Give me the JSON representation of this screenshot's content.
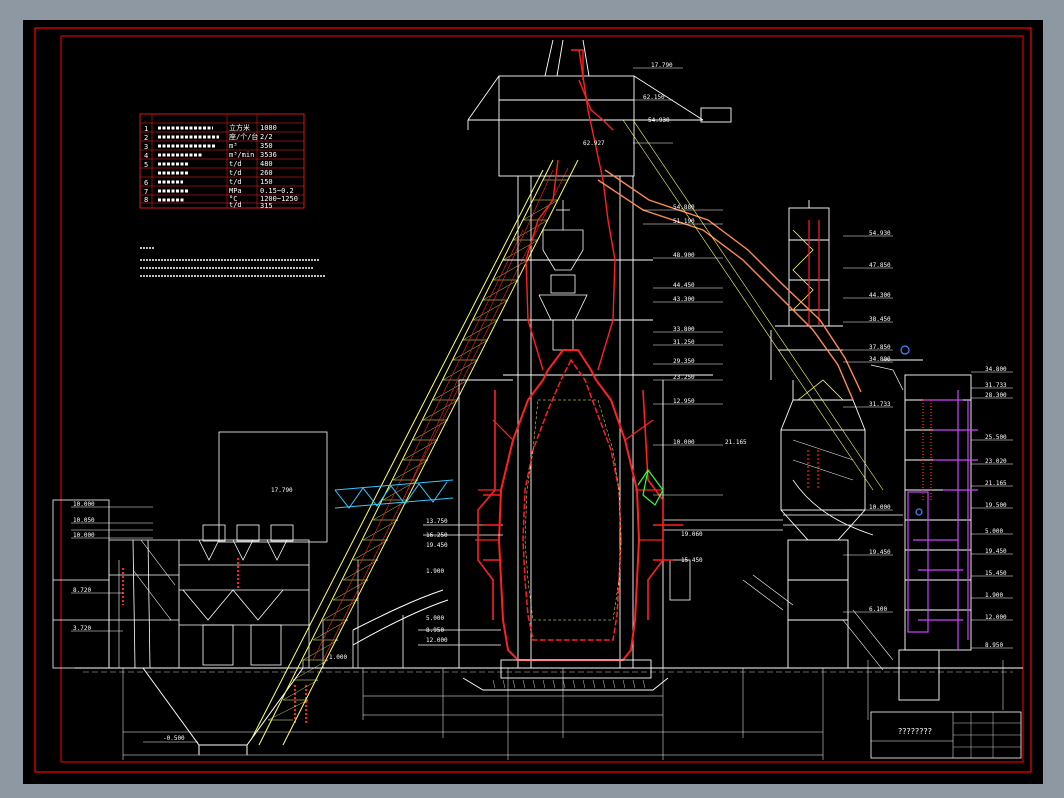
{
  "title_block": {
    "title": "????????"
  },
  "spec_table": {
    "numbers": [
      "1",
      "2",
      "3",
      "4",
      "5",
      "6",
      "7",
      "8"
    ],
    "units": [
      "立方米",
      "座/个/台",
      "m³",
      "m³/min",
      "t/d",
      "t/h",
      "MPa",
      "°C",
      "t/d",
      "t/d",
      "t/h"
    ],
    "values": [
      "1080",
      "2/2",
      "350",
      "3536",
      "480",
      "260",
      "150",
      "0.15~0.2",
      "1200~1250",
      "315"
    ]
  },
  "elevations": [
    "17.790",
    "62.927",
    "54.880",
    "51.190",
    "48.900",
    "44.450",
    "43.300",
    "33.800",
    "31.250",
    "29.350",
    "23.250",
    "12.950",
    "10.000",
    "62.150",
    "54.930",
    "47.850",
    "44.300",
    "38.450",
    "37.850",
    "34.800",
    "31.733",
    "28.300",
    "25.500",
    "23.020",
    "21.165",
    "19.500",
    "10.000",
    "6.100",
    "13.750",
    "16.250",
    "19.450",
    "19.060",
    "15.450",
    "12.000",
    "8.950",
    "5.000",
    "1.900",
    "10.000",
    "10.050",
    "8.720",
    "3.720",
    "1.000",
    "-0.500"
  ],
  "colors": {
    "background": "#000000",
    "border": "#ff0000",
    "structure": "#ffffff",
    "furnace": "#ff2020",
    "trestle": "#ffff66",
    "pipe": "#ff8a50",
    "bridge": "#33c8ff",
    "equipment": "#cc44ff",
    "highlight": "#33ff33"
  }
}
